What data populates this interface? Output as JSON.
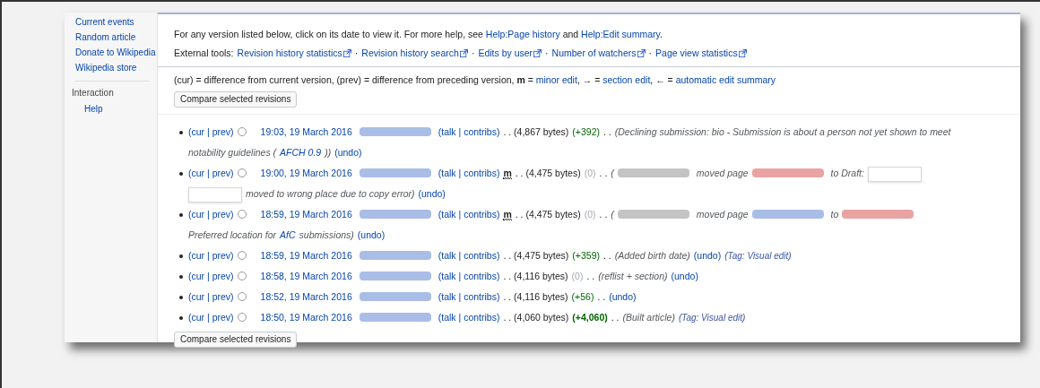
{
  "sidebar": {
    "items": [
      {
        "label": "Current events"
      },
      {
        "label": "Random article"
      },
      {
        "label": "Donate to Wikipedia"
      },
      {
        "label": "Wikipedia store"
      }
    ],
    "section": {
      "heading": "Interaction",
      "items": [
        {
          "label": "Help"
        }
      ]
    }
  },
  "help_line": [
    {
      "kind": "text",
      "text": "For any version listed below, click on its date to view it. For more help, see "
    },
    {
      "kind": "link",
      "text": "Help:Page history"
    },
    {
      "kind": "text",
      "text": " and "
    },
    {
      "kind": "link",
      "text": "Help:Edit summary"
    },
    {
      "kind": "text",
      "text": "."
    }
  ],
  "external_tools": {
    "label": "External tools:",
    "separator": "·",
    "links": [
      "Revision history statistics",
      "Revision history search",
      "Edits by user",
      "Number of watchers",
      "Page view statistics"
    ]
  },
  "legend": [
    {
      "kind": "text",
      "text": "(cur) = difference from current version, (prev) = difference from preceding version, "
    },
    {
      "kind": "bold",
      "text": "m"
    },
    {
      "kind": "text",
      "text": " = "
    },
    {
      "kind": "link",
      "text": "minor edit"
    },
    {
      "kind": "text",
      "text": ", → = "
    },
    {
      "kind": "link",
      "text": "section edit"
    },
    {
      "kind": "text",
      "text": ", ← = "
    },
    {
      "kind": "link",
      "text": "automatic edit summary"
    }
  ],
  "compare_button_top": "Compare selected revisions",
  "revisions": [
    {
      "segments": [
        {
          "kind": "link",
          "text": "(cur | prev)"
        },
        {
          "kind": "radio",
          "selected": false
        },
        {
          "kind": "date",
          "text": "19:03, 19 March 2016"
        },
        {
          "kind": "blur",
          "color": "#a9bde6"
        },
        {
          "kind": "link",
          "text": "(talk | contribs)"
        },
        {
          "kind": "text",
          "text": ". . (4,867 bytes)"
        },
        {
          "kind": "change",
          "color": "#006400",
          "text": "(+392)"
        },
        {
          "kind": "text",
          "text": ". ."
        },
        {
          "kind": "italic",
          "text": "(Declining submission: bio - Submission is about a person not yet shown to meet"
        },
        {
          "kind": "break"
        },
        {
          "kind": "italic",
          "text": "notability guidelines ("
        },
        {
          "kind": "italic-link",
          "text": "AFCH 0.9"
        },
        {
          "kind": "italic",
          "text": "))"
        },
        {
          "kind": "link",
          "text": "(undo)"
        }
      ]
    },
    {
      "segments": [
        {
          "kind": "link",
          "text": "(cur | prev)"
        },
        {
          "kind": "radio",
          "selected": false
        },
        {
          "kind": "date",
          "text": "19:00, 19 March 2016"
        },
        {
          "kind": "blur",
          "color": "#a9bde6"
        },
        {
          "kind": "link",
          "text": "(talk | contribs)"
        },
        {
          "kind": "minor",
          "text": "m"
        },
        {
          "kind": "text",
          "text": ". . (4,475 bytes)"
        },
        {
          "kind": "change",
          "color": "#a2a9b1",
          "text": "(0)"
        },
        {
          "kind": "text",
          "text": ". ."
        },
        {
          "kind": "italic",
          "text": "("
        },
        {
          "kind": "blur",
          "color": "#c4c4c4"
        },
        {
          "kind": "italic",
          "text": "moved page"
        },
        {
          "kind": "blur",
          "color": "#e9a3a3"
        },
        {
          "kind": "italic",
          "text": "to Draft:"
        },
        {
          "kind": "blank"
        },
        {
          "kind": "break"
        },
        {
          "kind": "blank"
        },
        {
          "kind": "italic",
          "text": "moved to wrong place due to copy error)"
        },
        {
          "kind": "link",
          "text": "(undo)"
        }
      ]
    },
    {
      "segments": [
        {
          "kind": "link",
          "text": "(cur | prev)"
        },
        {
          "kind": "radio",
          "selected": false
        },
        {
          "kind": "date",
          "text": "18:59, 19 March 2016"
        },
        {
          "kind": "blur",
          "color": "#a9bde6"
        },
        {
          "kind": "link",
          "text": "(talk | contribs)"
        },
        {
          "kind": "minor",
          "text": "m"
        },
        {
          "kind": "text",
          "text": ". . (4,475 bytes)"
        },
        {
          "kind": "change",
          "color": "#a2a9b1",
          "text": "(0)"
        },
        {
          "kind": "text",
          "text": ". ."
        },
        {
          "kind": "italic",
          "text": "("
        },
        {
          "kind": "blur",
          "color": "#c4c4c4"
        },
        {
          "kind": "italic",
          "text": "moved page"
        },
        {
          "kind": "blur",
          "color": "#a9bde6"
        },
        {
          "kind": "italic",
          "text": "to"
        },
        {
          "kind": "blur",
          "color": "#e9a3a3"
        },
        {
          "kind": "break"
        },
        {
          "kind": "italic",
          "text": "Preferred location for"
        },
        {
          "kind": "italic-link",
          "text": "AfC"
        },
        {
          "kind": "italic",
          "text": "submissions)"
        },
        {
          "kind": "link",
          "text": "(undo)"
        }
      ]
    },
    {
      "segments": [
        {
          "kind": "link",
          "text": "(cur | prev)"
        },
        {
          "kind": "radio",
          "selected": false
        },
        {
          "kind": "date",
          "text": "18:59, 19 March 2016"
        },
        {
          "kind": "blur",
          "color": "#a9bde6"
        },
        {
          "kind": "link",
          "text": "(talk | contribs)"
        },
        {
          "kind": "text",
          "text": ". . (4,475 bytes)"
        },
        {
          "kind": "change",
          "color": "#006400",
          "text": "(+359)"
        },
        {
          "kind": "text",
          "text": ". ."
        },
        {
          "kind": "italic",
          "text": "(Added birth date)"
        },
        {
          "kind": "link",
          "text": "(undo)"
        },
        {
          "kind": "tag",
          "text": "(Tag: Visual edit)"
        }
      ]
    },
    {
      "segments": [
        {
          "kind": "link",
          "text": "(cur | prev)"
        },
        {
          "kind": "radio",
          "selected": false
        },
        {
          "kind": "date",
          "text": "18:58, 19 March 2016"
        },
        {
          "kind": "blur",
          "color": "#a9bde6"
        },
        {
          "kind": "link",
          "text": "(talk | contribs)"
        },
        {
          "kind": "text",
          "text": ". . (4,116 bytes)"
        },
        {
          "kind": "change",
          "color": "#a2a9b1",
          "text": "(0)"
        },
        {
          "kind": "text",
          "text": ". ."
        },
        {
          "kind": "italic",
          "text": "(reflist + section)"
        },
        {
          "kind": "link",
          "text": "(undo)"
        }
      ]
    },
    {
      "segments": [
        {
          "kind": "link",
          "text": "(cur | prev)"
        },
        {
          "kind": "radio",
          "selected": false
        },
        {
          "kind": "date",
          "text": "18:52, 19 March 2016"
        },
        {
          "kind": "blur",
          "color": "#a9bde6"
        },
        {
          "kind": "link",
          "text": "(talk | contribs)"
        },
        {
          "kind": "text",
          "text": ". . (4,116 bytes)"
        },
        {
          "kind": "change",
          "color": "#006400",
          "text": "(+56)"
        },
        {
          "kind": "text",
          "text": ". ."
        },
        {
          "kind": "link",
          "text": "(undo)"
        }
      ]
    },
    {
      "segments": [
        {
          "kind": "link",
          "text": "(cur | prev)"
        },
        {
          "kind": "radio",
          "selected": false
        },
        {
          "kind": "date",
          "text": "18:50, 19 March 2016"
        },
        {
          "kind": "blur",
          "color": "#a9bde6"
        },
        {
          "kind": "link",
          "text": "(talk | contribs)"
        },
        {
          "kind": "text",
          "text": ". . (4,060 bytes)"
        },
        {
          "kind": "change",
          "color": "#006400",
          "strong": true,
          "text": "(+4,060)"
        },
        {
          "kind": "text",
          "text": ". ."
        },
        {
          "kind": "italic",
          "text": "(Built article)"
        },
        {
          "kind": "tag",
          "text": "(Tag: Visual edit)"
        }
      ]
    }
  ],
  "compare_button_bottom": "Compare selected revisions"
}
